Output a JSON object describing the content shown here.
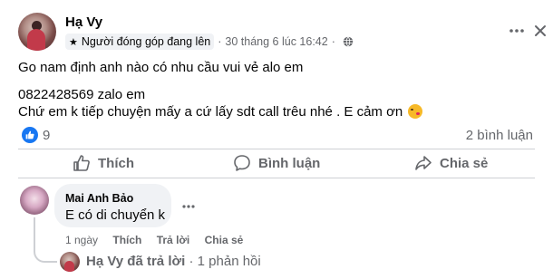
{
  "post": {
    "author": "Hạ Vy",
    "badge_label": "Người đóng góp đang lên",
    "timestamp": "30 tháng 6 lúc 16:42",
    "text_lines": [
      "Go nam định anh nào có nhu cầu vui vẻ alo em",
      "0822428569 zalo em",
      "Chứ em k tiếp chuyện mấy a cứ lấy sdt call trêu nhé . E cảm ơn"
    ],
    "reaction_count": "9",
    "comment_count": "2 bình luận",
    "icons": {
      "badge": "star-icon",
      "privacy": "globe-icon",
      "more": "more-dots-icon",
      "close": "close-icon",
      "reaction": "like-reaction-icon"
    }
  },
  "actions": {
    "like": "Thích",
    "comment": "Bình luận",
    "share": "Chia sẻ"
  },
  "comment": {
    "author": "Mai Anh Bảo",
    "text": "E có di chuyển k",
    "time": "1 ngày",
    "like": "Thích",
    "reply": "Trả lời",
    "share": "Chia sẻ"
  },
  "replies": {
    "author_replied": "Hạ Vy đã trả lời",
    "separator": "·",
    "count": "1 phản hồi"
  },
  "colors": {
    "accent": "#1877f2",
    "secondary_text": "#65676b",
    "bubble": "#f0f2f5",
    "divider": "#ced0d4"
  }
}
